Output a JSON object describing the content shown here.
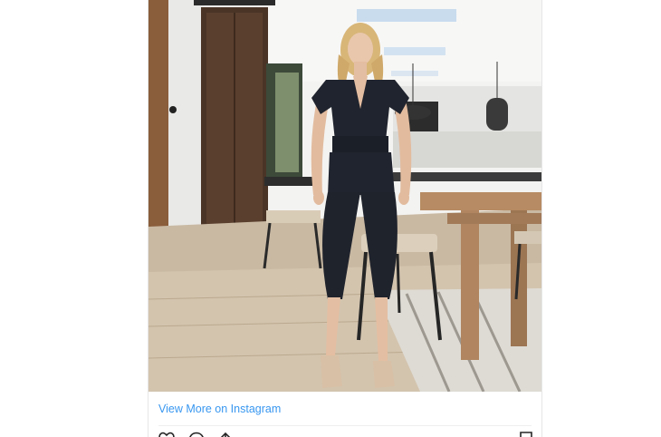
{
  "embed": {
    "view_more_link": "View More on Instagram"
  },
  "icons": {
    "like": "heart-icon",
    "comment": "comment-icon",
    "share": "share-icon",
    "save": "bookmark-icon"
  },
  "colors": {
    "link": "#3897f0",
    "border": "#e6e6e6"
  }
}
